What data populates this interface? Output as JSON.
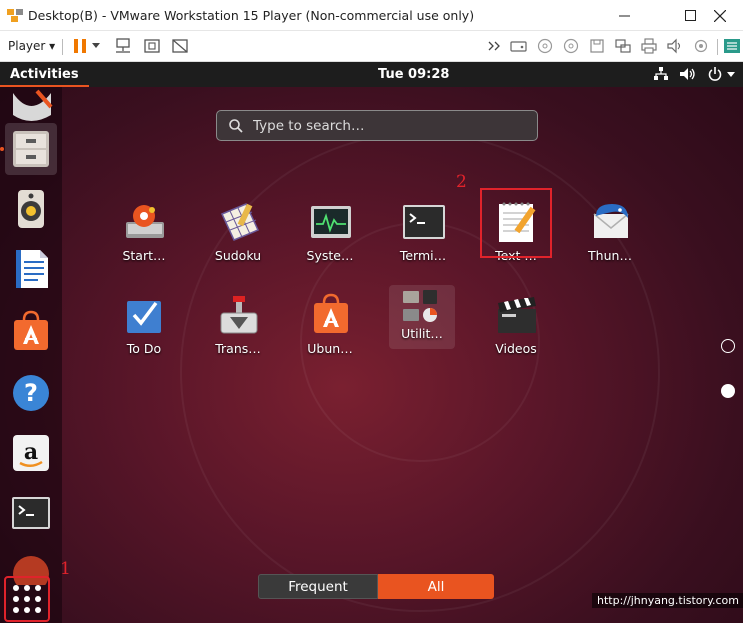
{
  "window": {
    "title": "Desktop(B) - VMware Workstation 15 Player (Non-commercial use only)",
    "minimize": "—",
    "maximize": "☐",
    "close": "✕"
  },
  "toolbar": {
    "player_label": "Player ▾"
  },
  "topbar": {
    "activities": "Activities",
    "clock": "Tue 09:28"
  },
  "search": {
    "placeholder": "Type to search…"
  },
  "apps": [
    {
      "label": "Start…",
      "icon": "startup-disk-icon"
    },
    {
      "label": "Sudoku",
      "icon": "sudoku-icon"
    },
    {
      "label": "Syste…",
      "icon": "system-monitor-icon"
    },
    {
      "label": "Termi…",
      "icon": "terminal-icon"
    },
    {
      "label": "Text …",
      "icon": "text-editor-icon"
    },
    {
      "label": "Thun…",
      "icon": "thunderbird-icon"
    },
    {
      "label": "To Do",
      "icon": "todo-icon"
    },
    {
      "label": "Trans…",
      "icon": "transmission-icon"
    },
    {
      "label": "Ubun…",
      "icon": "ubuntu-software-icon"
    },
    {
      "label": "Utilit…",
      "icon": "utilities-folder-icon"
    },
    {
      "label": "Videos",
      "icon": "videos-icon"
    }
  ],
  "annotations": {
    "one": "1",
    "two": "2"
  },
  "view_toggle": {
    "frequent": "Frequent",
    "all": "All",
    "selected": "All"
  },
  "watermark": "http://jhnyang.tistory.com",
  "colors": {
    "accent": "#e95420",
    "highlight": "#e0232b",
    "topbar": "#1d1d1d"
  }
}
